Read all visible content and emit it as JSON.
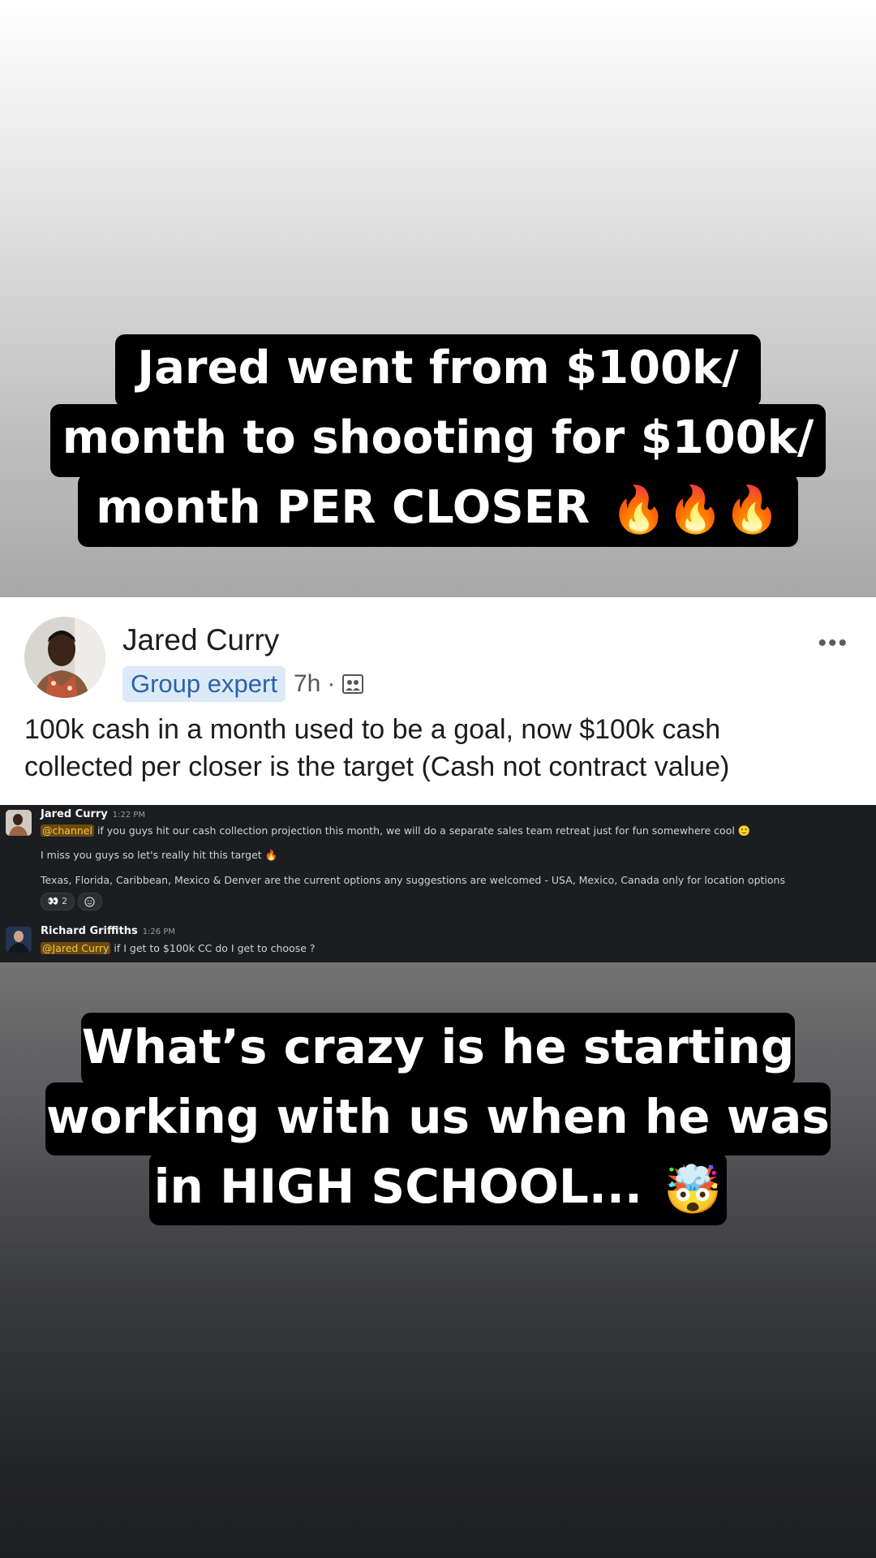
{
  "caption_top": {
    "lines": [
      "Jared went from $100k/",
      "month to shooting for $100k/",
      "month PER CLOSER"
    ],
    "emoji": "🔥🔥🔥"
  },
  "post": {
    "author": "Jared Curry",
    "badge": "Group expert",
    "time": "7h",
    "separator": "·",
    "more": "•••",
    "body_line1": "100k cash in a month used to be a goal, now $100k cash",
    "body_line2": "collected per closer is the target (Cash not contract value)"
  },
  "slack": {
    "messages": [
      {
        "author": "Jared Curry",
        "time": "1:22 PM",
        "mention": "@channel",
        "line1": " if you guys hit our cash collection projection this month, we will do a separate sales team retreat just for fun somewhere cool 🙂",
        "line2": "I miss you guys so let's really hit this target 🔥",
        "line3": "Texas, Florida, Caribbean, Mexico & Denver are the current options any suggestions are welcomed - USA, Mexico, Canada only for location options",
        "reaction_emoji": "👀",
        "reaction_count": "2"
      },
      {
        "author": "Richard Griffiths",
        "time": "1:26 PM",
        "mention": "@Jared Curry",
        "text": " if I get to $100k CC do I get to choose ?"
      }
    ]
  },
  "caption_bottom": {
    "lines": [
      "What’s crazy is he starting",
      "working with us when he was",
      "in HIGH SCHOOL..."
    ],
    "emoji": "🤯"
  }
}
